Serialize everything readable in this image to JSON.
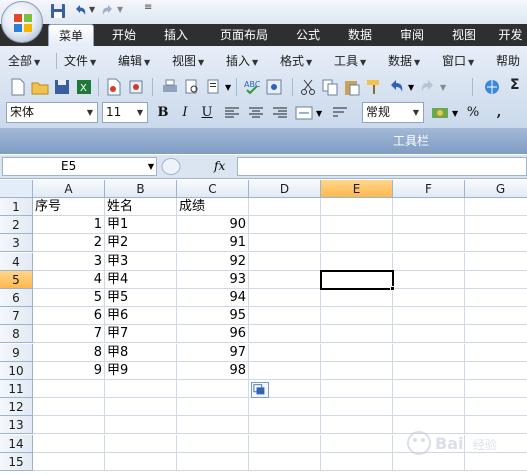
{
  "quick_access": {
    "buttons": [
      "save-icon",
      "undo-icon",
      "redo-icon",
      "customize-icon"
    ]
  },
  "ribbon_tabs": [
    {
      "label": "菜单",
      "active": true
    },
    {
      "label": "开始"
    },
    {
      "label": "插入"
    },
    {
      "label": "页面布局"
    },
    {
      "label": "公式"
    },
    {
      "label": "数据"
    },
    {
      "label": "审阅"
    },
    {
      "label": "视图"
    },
    {
      "label": "开发"
    }
  ],
  "menu_bar": [
    {
      "label": "全部"
    },
    {
      "label": "文件"
    },
    {
      "label": "编辑"
    },
    {
      "label": "视图"
    },
    {
      "label": "插入"
    },
    {
      "label": "格式"
    },
    {
      "label": "工具"
    },
    {
      "label": "数据"
    },
    {
      "label": "窗口"
    },
    {
      "label": "帮助"
    }
  ],
  "format_bar": {
    "font_name": "宋体",
    "font_size": "11",
    "bold": "B",
    "italic": "I",
    "underline": "U",
    "number_format": "常规",
    "percent": "%",
    "comma": ",",
    "sigma": "Σ"
  },
  "toolbar_group_label": "工具栏",
  "formula_bar": {
    "name_box": "E5",
    "fx": "fx",
    "formula": ""
  },
  "sheet": {
    "columns": [
      "A",
      "B",
      "C",
      "D",
      "E",
      "F",
      "G"
    ],
    "rows": [
      "1",
      "2",
      "3",
      "4",
      "5",
      "6",
      "7",
      "8",
      "9",
      "10",
      "11",
      "12",
      "13",
      "14",
      "15"
    ],
    "selected_cell": "E5",
    "cells": {
      "A1": "序号",
      "B1": "姓名",
      "C1": "成绩",
      "A2": "1",
      "B2": "甲1",
      "C2": "90",
      "A3": "2",
      "B3": "甲2",
      "C3": "91",
      "A4": "3",
      "B4": "甲3",
      "C4": "92",
      "A5": "4",
      "B5": "甲4",
      "C5": "93",
      "A6": "5",
      "B6": "甲5",
      "C6": "94",
      "A7": "6",
      "B7": "甲6",
      "C7": "95",
      "A8": "7",
      "B8": "甲7",
      "C8": "96",
      "A9": "8",
      "B9": "甲8",
      "C9": "97",
      "A10": "9",
      "B10": "甲9",
      "C10": "98"
    },
    "numeric_columns": [
      "A",
      "C"
    ]
  },
  "colors": {
    "tab_bar": "#2f2f2f",
    "ribbon": "#d8e3f1",
    "header_selected": "#ffb84d",
    "grid_line": "#d0d7e5"
  }
}
